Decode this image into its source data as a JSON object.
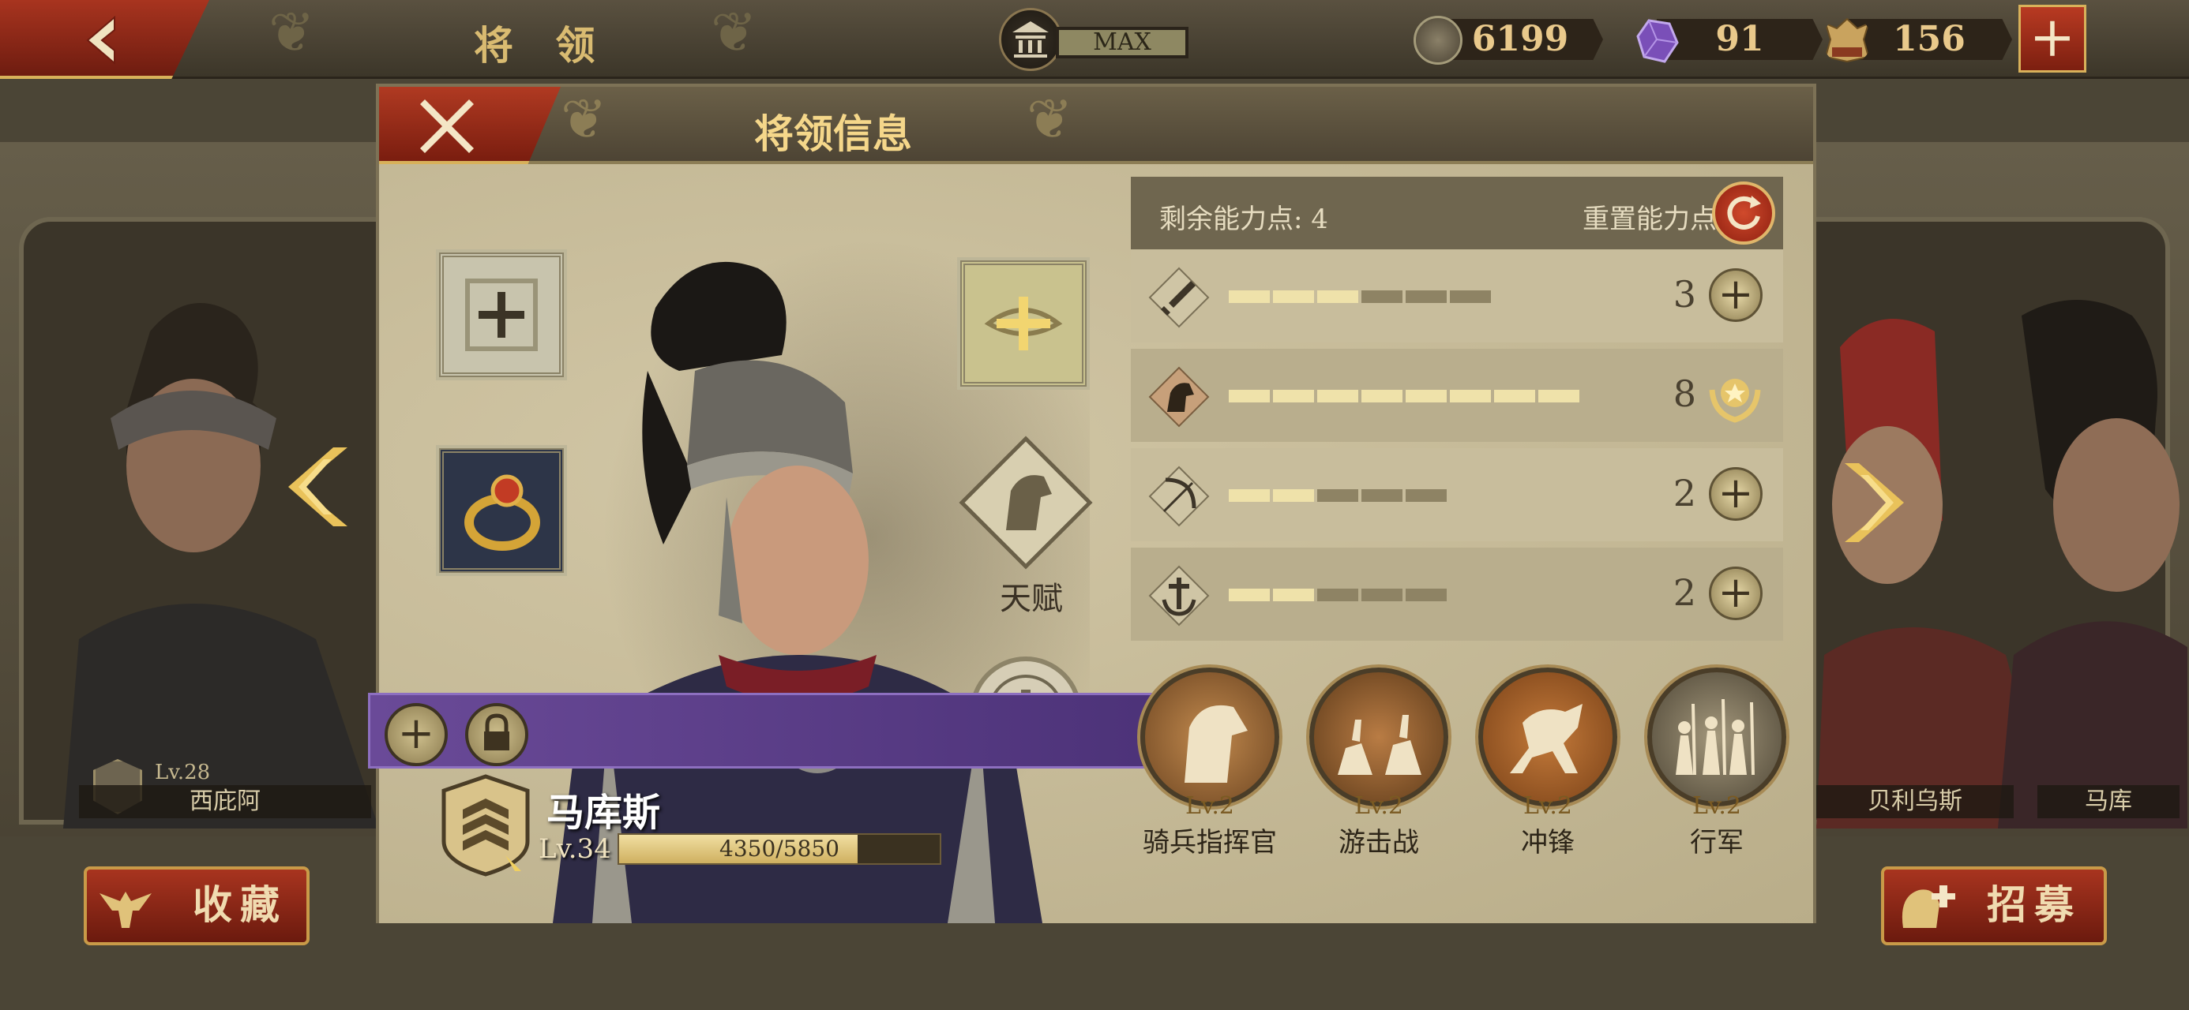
{
  "topbar": {
    "title": "将 领",
    "rank_label": "MAX",
    "resources": [
      {
        "icon": "silver-coin-icon",
        "value": "6199"
      },
      {
        "icon": "purple-gem-icon",
        "value": "91"
      },
      {
        "icon": "laurel-spqr-icon",
        "value": "156"
      }
    ]
  },
  "background": {
    "left_general": {
      "name": "西庇阿",
      "level": "Lv.28"
    },
    "right_general_a": {
      "name": "贝利乌斯"
    },
    "right_general_b": {
      "name": "马库"
    }
  },
  "buttons": {
    "favorite": "收藏",
    "recruit": "招募"
  },
  "dialog": {
    "title": "将领信息",
    "talent_label": "天赋",
    "hero": {
      "name": "马库斯",
      "level": "Lv.34",
      "xp_text": "4350/5850",
      "xp_fraction": 0.744
    }
  },
  "stats": {
    "remaining_label": "剩余能力点: 4",
    "reset_label": "重置能力点",
    "rows": [
      {
        "icon": "sword-icon",
        "value": "3",
        "filled": 3,
        "total": 6,
        "action": "plus"
      },
      {
        "icon": "horse-icon",
        "value": "8",
        "filled": 8,
        "total": 8,
        "action": "max-badge"
      },
      {
        "icon": "bow-icon",
        "value": "2",
        "filled": 2,
        "total": 5,
        "action": "plus"
      },
      {
        "icon": "anchor-icon",
        "value": "2",
        "filled": 2,
        "total": 5,
        "action": "plus"
      }
    ]
  },
  "skills": [
    {
      "level": "Lv.2",
      "name": "骑兵指挥官",
      "icon": "horse-head-icon"
    },
    {
      "level": "Lv.2",
      "name": "游击战",
      "icon": "riders-icon"
    },
    {
      "level": "Lv.2",
      "name": "冲锋",
      "icon": "charging-horse-icon"
    },
    {
      "level": "Lv.2",
      "name": "行军",
      "icon": "marching-soldiers-icon"
    }
  ],
  "colors": {
    "accent_red": "#a8341f",
    "gold": "#d8b15a",
    "segment_filled": "#efe2aa",
    "segment_empty": "#8e8364"
  }
}
